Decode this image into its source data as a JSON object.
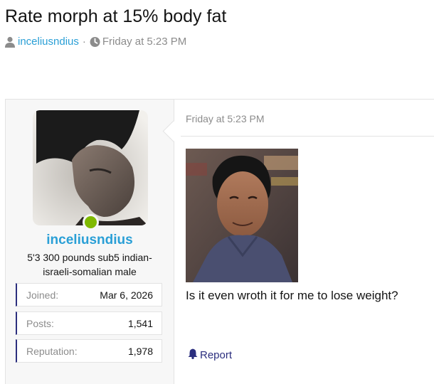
{
  "thread": {
    "title": "Rate morph at 15% body fat",
    "author": "inceliusndius",
    "separator": "·",
    "date": "Friday at 5:23 PM"
  },
  "user": {
    "name": "inceliusndius",
    "title": "5'3 300 pounds sub5 indian-israeli-somalian male",
    "online": true,
    "online_color": "#7fb900",
    "stats": [
      {
        "label": "Joined:",
        "value": "Mar 6, 2026"
      },
      {
        "label": "Posts:",
        "value": "1,541"
      },
      {
        "label": "Reputation:",
        "value": "1,978"
      }
    ]
  },
  "post": {
    "date": "Friday at 5:23 PM",
    "body": "Is it even wroth it for me to lose weight?",
    "report_label": "Report"
  },
  "colors": {
    "link": "#2a9fd6",
    "stat_accent": "#2b2e7e",
    "muted_text": "#8c8c8c",
    "panel_bg": "#f7f7f7"
  },
  "icons": [
    "user-icon",
    "clock-icon",
    "bell-icon"
  ]
}
